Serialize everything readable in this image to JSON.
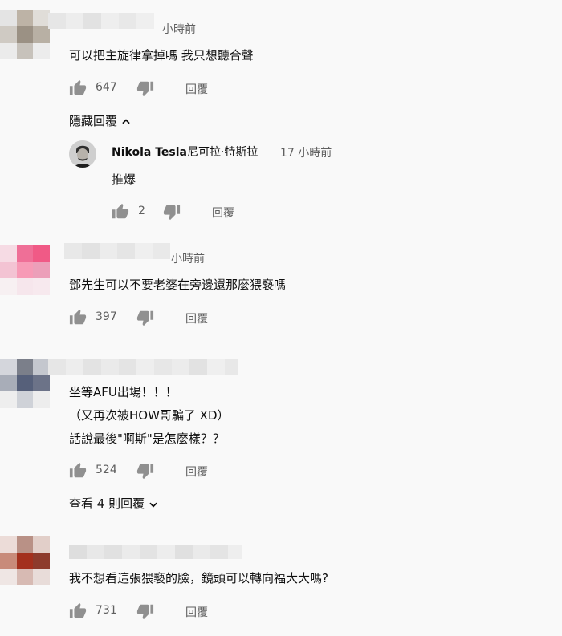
{
  "icons": {
    "like": "thumb-up-icon",
    "dislike": "thumb-down-icon",
    "chevron_up": "chevron-up-icon",
    "chevron_down": "chevron-down-icon"
  },
  "comments": [
    {
      "time": "小時前",
      "lines": [
        "可以把主旋律拿掉嗎 我只想聽合聲"
      ],
      "likes": "647",
      "reply_label": "回覆",
      "toggle_label": "隱藏回覆",
      "replies": [
        {
          "author": "Nikola Tesla",
          "author_cn": "尼可拉·特斯拉",
          "time": "17 小時前",
          "text": "推爆",
          "likes": "2",
          "reply_label": "回覆"
        }
      ]
    },
    {
      "time": "小時前",
      "lines": [
        "鄧先生可以不要老婆在旁邊還那麼猥褻嗎"
      ],
      "likes": "397",
      "reply_label": "回覆"
    },
    {
      "time": "",
      "lines": [
        "坐等AFU出場！！！",
        "（又再次被HOW哥騙了 XD）",
        "話說最後\"啊斯\"是怎麼樣？？"
      ],
      "likes": "524",
      "reply_label": "回覆",
      "toggle_label": "查看 4 則回覆"
    },
    {
      "time": "",
      "lines": [
        "我不想看這張猥褻的臉，鏡頭可以轉向福大大嗎?"
      ],
      "likes": "731",
      "reply_label": "回覆"
    }
  ]
}
